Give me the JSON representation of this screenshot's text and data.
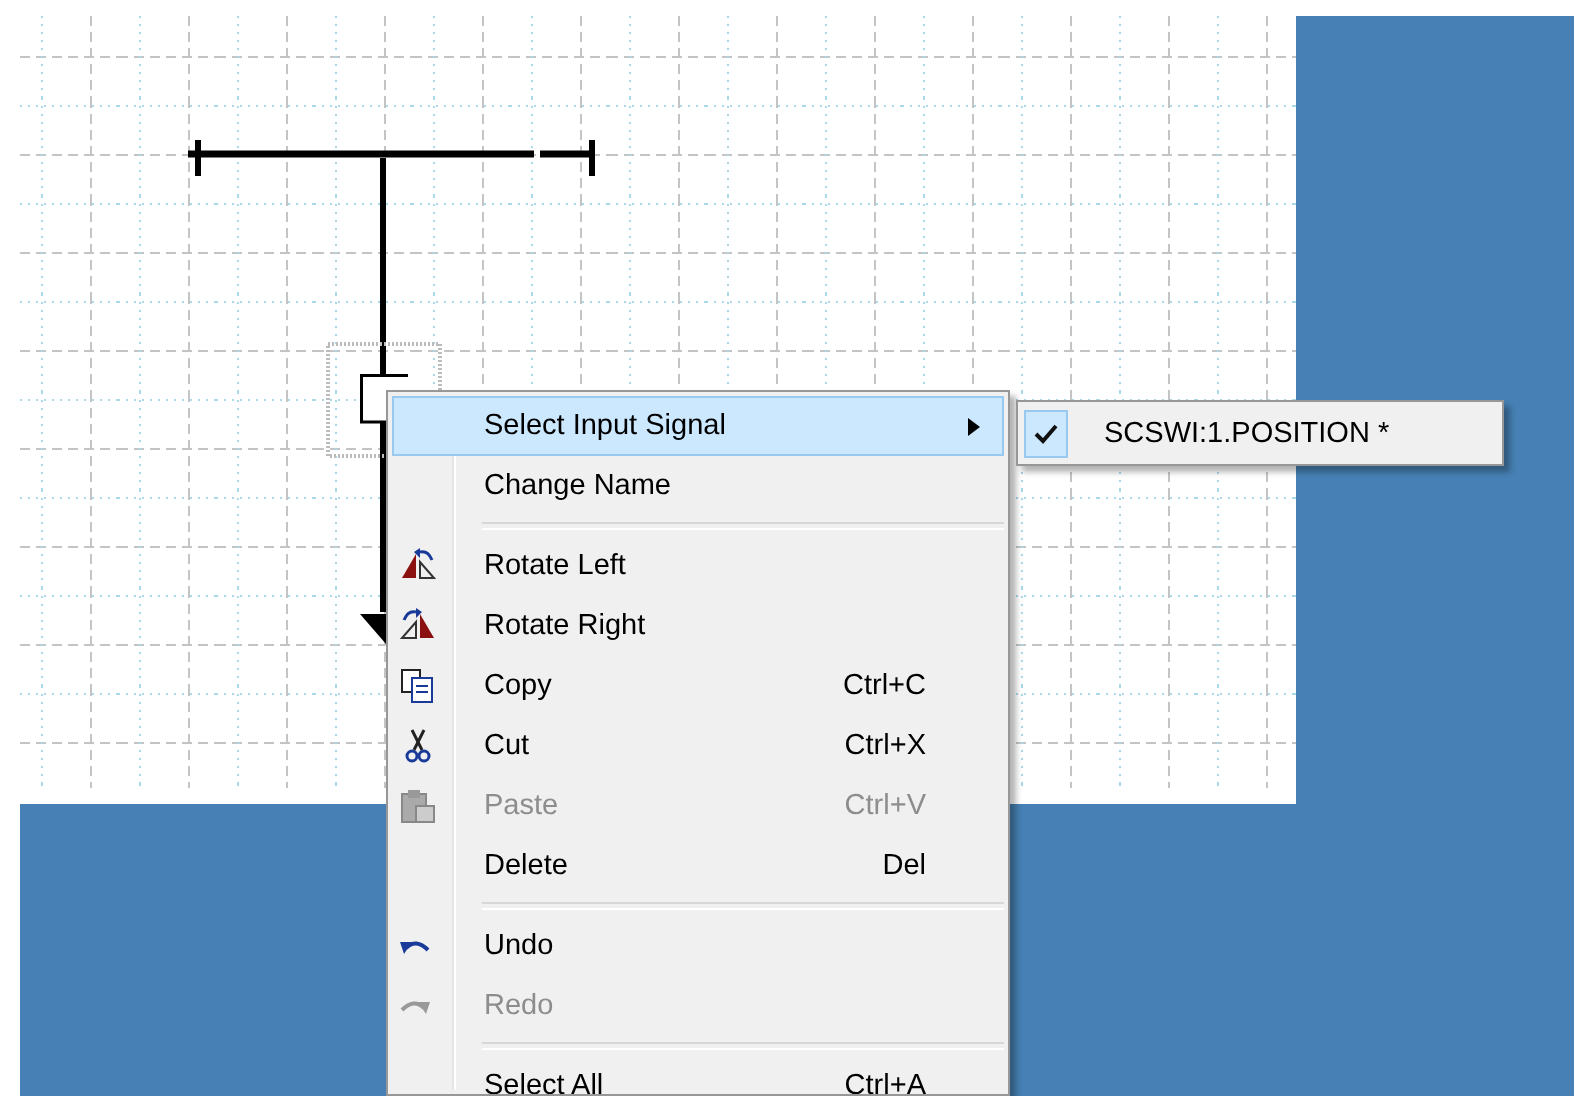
{
  "context_menu": {
    "items": [
      {
        "kind": "item",
        "label": "Select Input Signal",
        "selected": true,
        "disabled": false,
        "has_submenu": true
      },
      {
        "kind": "item",
        "label": "Change Name",
        "selected": false,
        "disabled": false,
        "has_submenu": false
      },
      {
        "kind": "separator"
      },
      {
        "kind": "item",
        "label": "Rotate Left",
        "selected": false,
        "disabled": false,
        "has_submenu": false
      },
      {
        "kind": "item",
        "label": "Rotate Right",
        "selected": false,
        "disabled": false,
        "has_submenu": false
      },
      {
        "kind": "item",
        "label": "Copy",
        "shortcut": "Ctrl+C",
        "selected": false,
        "disabled": false,
        "has_submenu": false
      },
      {
        "kind": "item",
        "label": "Cut",
        "shortcut": "Ctrl+X",
        "selected": false,
        "disabled": false,
        "has_submenu": false
      },
      {
        "kind": "item",
        "label": "Paste",
        "shortcut": "Ctrl+V",
        "selected": false,
        "disabled": true,
        "has_submenu": false
      },
      {
        "kind": "item",
        "label": "Delete",
        "shortcut": "Del",
        "selected": false,
        "disabled": false,
        "has_submenu": false
      },
      {
        "kind": "separator"
      },
      {
        "kind": "item",
        "label": "Undo",
        "selected": false,
        "disabled": false,
        "has_submenu": false
      },
      {
        "kind": "item",
        "label": "Redo",
        "selected": false,
        "disabled": true,
        "has_submenu": false
      },
      {
        "kind": "separator"
      },
      {
        "kind": "item",
        "label": "Select All",
        "shortcut": "Ctrl+A",
        "selected": false,
        "disabled": false,
        "has_submenu": false
      }
    ]
  },
  "submenu": {
    "items": [
      {
        "label": "SCSWI:1.POSITION *",
        "checked": true
      }
    ]
  }
}
